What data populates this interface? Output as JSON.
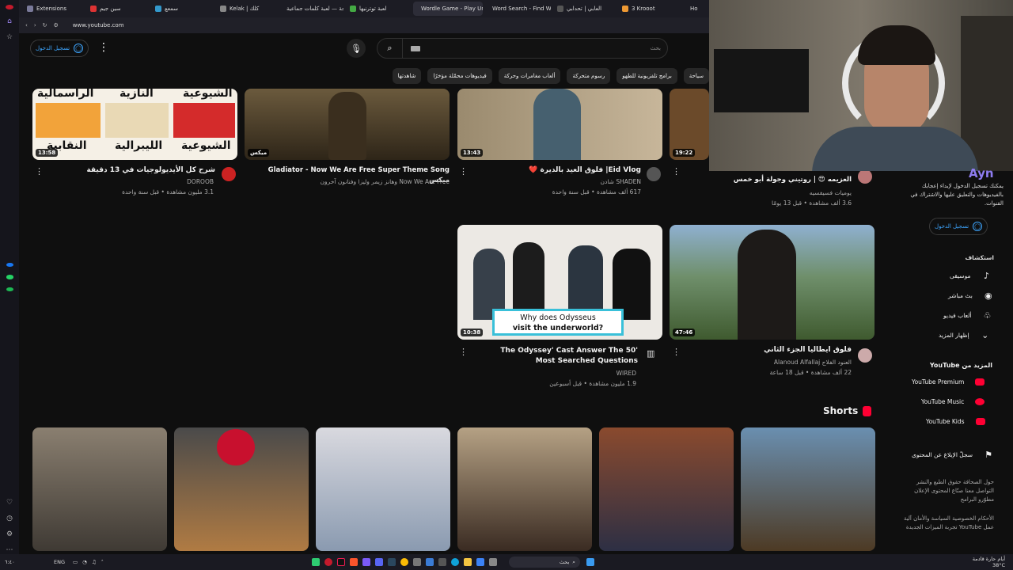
{
  "browser": {
    "tabs": [
      "Extensions",
      "سين جيم",
      "سمعع",
      "Kelak | كلك",
      "لمحة — لعبة كلمات جماعية",
      "لعبة توترنيها",
      "Wordle Game - Play Unlim",
      "Word Search - Find Words",
      "العابي | تحدابي",
      "3 Krooot",
      "Ho"
    ],
    "url": "www.youtube.com"
  },
  "header": {
    "signin_label": "تسجيل الدخول",
    "search_placeholder": "بحث"
  },
  "chips": [
    "سياحة",
    "برامج تلفزيونية للطهو",
    "رسوم متحركة",
    "ألعاب مغامرات وحركة",
    "فيديوهات محمّلة مؤخرًا",
    "شاهدتها"
  ],
  "videos": [
    {
      "title": "شرح كل الأيديولوجيات في 13 دقيقة",
      "channel": "DOROOB",
      "meta": "3.1 مليون مشاهدة • قبل سنة واحدة",
      "duration": "13:58"
    },
    {
      "title": "Gladiator - Now We Are Free Super Theme Song ميكس",
      "channel": "Now We Are Free وهانز زيمر وليزا وفنانون آخرون",
      "meta": "",
      "duration": "ميكس"
    },
    {
      "title": "Eid Vlog| فلوق العيد بالديرة ❤️",
      "channel": "SHADEN شادن",
      "meta": "617 ألف مشاهدة • قبل سنة واحدة",
      "duration": "13:43"
    },
    {
      "title": "العزيمه 😍 | روتيني وجولة أبو خمس",
      "channel": "يوميات فسيفسيه",
      "meta": "3.6 ألف مشاهدة • قبل 13 يومًا",
      "duration": "19:22"
    },
    {
      "title": "'The Odyssey' Cast Answer The 50 Most Searched Questions",
      "channel": "WIRED",
      "meta": "1.9 مليون مشاهدة • قبل أسبوعين",
      "duration": "10:38",
      "caption_line1": "Why does Odysseus",
      "caption_line2": "visit the underworld?"
    },
    {
      "title": "فلوق ايطاليا الجزء الثاني",
      "channel": "العنود الفلاج Alanoud Alfallaj",
      "meta": "22 ألف مشاهدة • قبل 18 ساعة",
      "duration": "47:46"
    }
  ],
  "thumb_words": [
    "الرأسمالية",
    "النازية",
    "الشيوعية",
    "النقابية",
    "الليبرالية",
    "الشيوعية"
  ],
  "sidebar": {
    "promo": "يمكنك تسجيل الدخول لإبداء إعجابك بالفيديوهات والتعليق عليها والاشتراك في القنوات.",
    "signin_label": "تسجيل الدخول",
    "explore_title": "استكشاف",
    "explore_items": [
      "موسيقى",
      "بث مباشر",
      "ألعاب فيديو",
      "إظهار المزيد"
    ],
    "more_title": "المزيد من YouTube",
    "more_items": [
      "YouTube Premium",
      "YouTube Music",
      "YouTube Kids"
    ],
    "report": "سجلّ الإبلاغ عن المحتوى",
    "footer1": "حول  الصحافة  حقوق الطبع والنشر  التواصل معنا  صنّاع المحتوى  الإعلان  مطوّرو البرامج",
    "footer2": "الأحكام  الخصوصية  السياسة والأمان  آلية عمل YouTube  تجربة الميزات الجديدة"
  },
  "shorts": {
    "title": "Shorts"
  },
  "overlay_text": "Ayn",
  "taskbar": {
    "lang": "ENG",
    "search": "بحث",
    "weather": "أيام حارة قادمة",
    "temp": "38°C"
  },
  "colors": {
    "accent": "#3ea6ff",
    "youtube_red": "#ff0033",
    "background": "#0f0f0f"
  }
}
